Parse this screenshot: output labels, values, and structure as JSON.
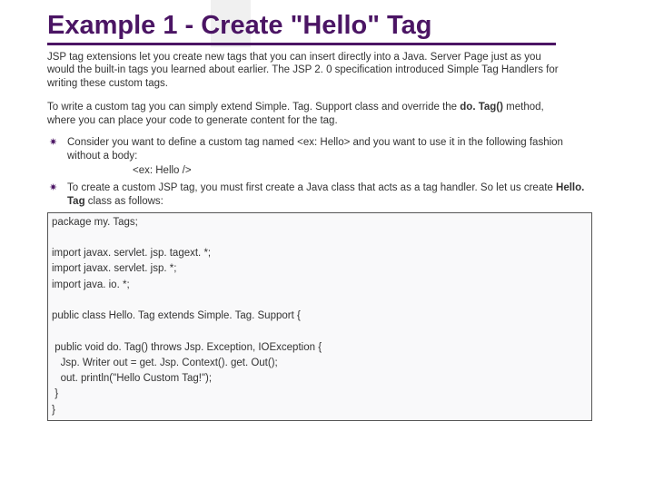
{
  "title": "Example 1 - Create \"Hello\" Tag",
  "intro": "JSP tag extensions let you create new tags that you can insert directly into a Java. Server Page just as you would the built-in tags you learned about earlier.   The JSP 2. 0 specification introduced Simple Tag Handlers for writing these custom tags.",
  "subintro_pre": "To write a custom tag you can simply extend Simple. Tag. Support class and override the ",
  "subintro_bold": "do. Tag()",
  "subintro_post": " method, where you can place your code to generate content for the tag.",
  "bullet1": "Consider you want to define a custom tag named <ex: Hello> and you want to use it in the following fashion without a body:",
  "bullet1_sub": "<ex: Hello />",
  "bullet2_pre": "To create a custom JSP tag, you must first create a Java class that acts as a tag handler. So let us create ",
  "bullet2_bold": "Hello. Tag",
  "bullet2_post": " class as follows:",
  "code": "package my. Tags;\n\nimport javax. servlet. jsp. tagext. *;\nimport javax. servlet. jsp. *;\nimport java. io. *;\n\npublic class Hello. Tag extends Simple. Tag. Support {\n\n public void do. Tag() throws Jsp. Exception, IOException {\n   Jsp. Writer out = get. Jsp. Context(). get. Out();\n   out. println(\"Hello Custom Tag!\");\n }\n}"
}
